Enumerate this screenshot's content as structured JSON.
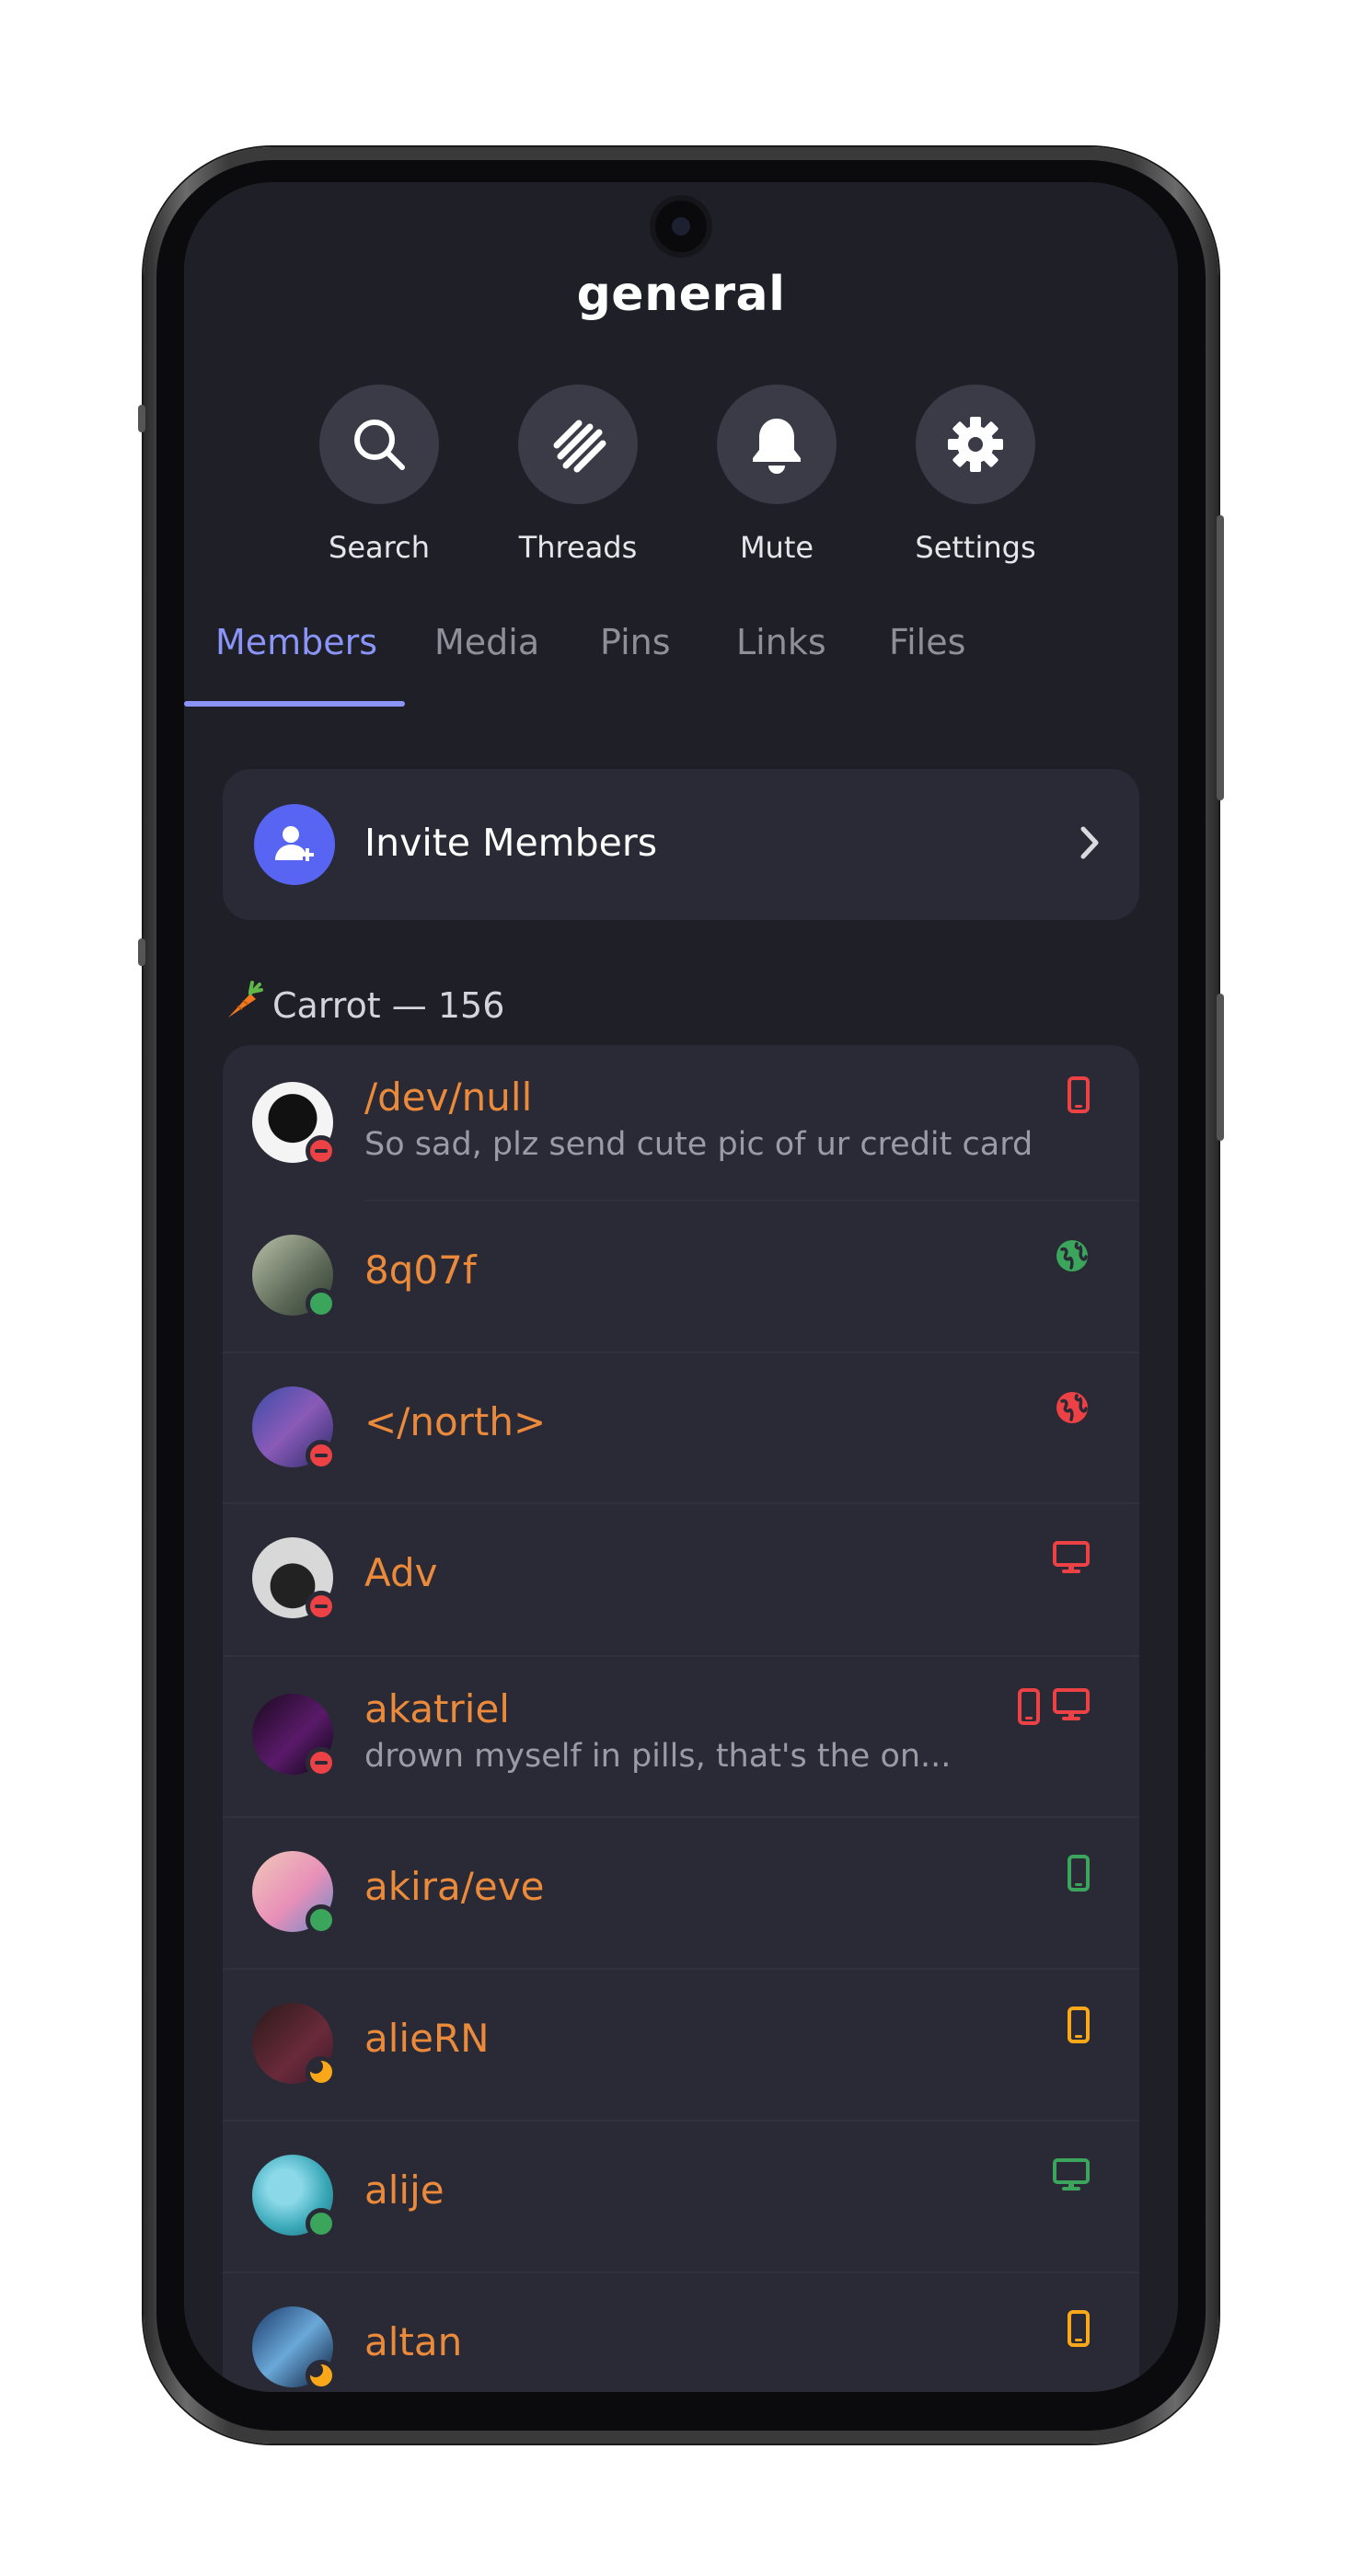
{
  "header": {
    "title": "general"
  },
  "actions": [
    {
      "label": "Search",
      "icon": "search-icon"
    },
    {
      "label": "Threads",
      "icon": "threads-icon"
    },
    {
      "label": "Mute",
      "icon": "bell-icon"
    },
    {
      "label": "Settings",
      "icon": "gear-icon"
    }
  ],
  "tabs": [
    {
      "label": "Members",
      "active": true
    },
    {
      "label": "Media"
    },
    {
      "label": "Pins"
    },
    {
      "label": "Links"
    },
    {
      "label": "Files"
    }
  ],
  "invite": {
    "label": "Invite Members",
    "icon": "add-user-icon"
  },
  "section": {
    "emoji": "carrot-emoji",
    "label": "Carrot — 156"
  },
  "colors": {
    "accent": "#8b94f7",
    "blurple": "#5865f2",
    "username": "#ec8a3b",
    "online": "#3ba55c",
    "dnd": "#ed4245",
    "idle": "#faa81a"
  },
  "members": [
    {
      "name": "/dev/null",
      "status_text": "So sad, plz send cute pic of ur credit card",
      "presence": "dnd",
      "devices": [
        {
          "type": "mobile-icon",
          "color": "#ed4245"
        }
      ]
    },
    {
      "name": "8q07f",
      "status_text": "",
      "presence": "online",
      "devices": [
        {
          "type": "globe-icon",
          "color": "#3ba55c"
        }
      ]
    },
    {
      "name": "</north>",
      "status_text": "",
      "presence": "dnd",
      "devices": [
        {
          "type": "globe-icon",
          "color": "#ed4245"
        }
      ]
    },
    {
      "name": "Adv",
      "status_text": "",
      "presence": "dnd",
      "devices": [
        {
          "type": "desktop-icon",
          "color": "#ed4245"
        }
      ]
    },
    {
      "name": "akatriel",
      "status_text": "drown myself in pills, that's the on...",
      "presence": "dnd",
      "devices": [
        {
          "type": "mobile-icon",
          "color": "#ed4245"
        },
        {
          "type": "desktop-icon",
          "color": "#ed4245"
        }
      ]
    },
    {
      "name": "akira/eve",
      "status_text": "",
      "presence": "online",
      "devices": [
        {
          "type": "mobile-icon",
          "color": "#3ba55c"
        }
      ]
    },
    {
      "name": "alieRN",
      "status_text": "",
      "presence": "idle",
      "devices": [
        {
          "type": "mobile-icon",
          "color": "#faa81a"
        }
      ]
    },
    {
      "name": "alije",
      "status_text": "",
      "presence": "online",
      "devices": [
        {
          "type": "desktop-icon",
          "color": "#3ba55c"
        }
      ]
    },
    {
      "name": "altan",
      "status_text": "",
      "presence": "idle",
      "devices": [
        {
          "type": "mobile-icon",
          "color": "#faa81a"
        }
      ]
    }
  ]
}
